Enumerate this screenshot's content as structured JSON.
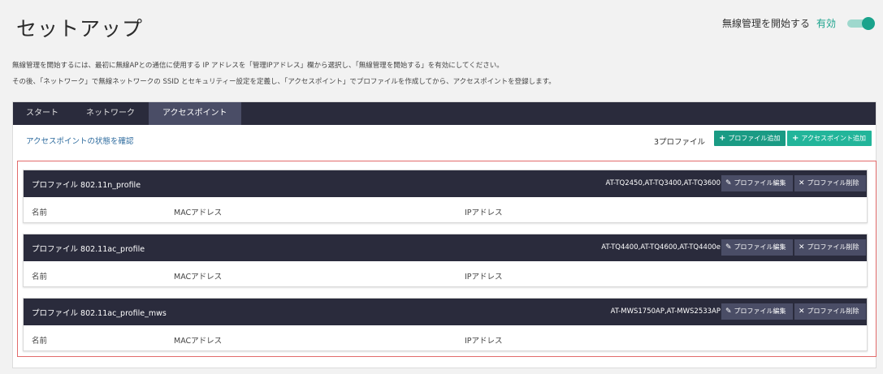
{
  "header": {
    "title": "セットアップ",
    "wireless_label": "無線管理を開始する",
    "wireless_status": "有効",
    "toggle_on": true
  },
  "instructions": {
    "line1": "無線管理を開始するには、最初に無線APとの通信に使用する IP アドレスを「管理IPアドレス」欄から選択し、「無線管理を開始する」を有効にしてください。",
    "line2": "その後、「ネットワーク」で無線ネットワークの SSID とセキュリティー設定を定義し、「アクセスポイント」でプロファイルを作成してから、アクセスポイントを登録します。"
  },
  "tabs": [
    {
      "label": "スタート",
      "active": false
    },
    {
      "label": "ネットワーク",
      "active": false
    },
    {
      "label": "アクセスポイント",
      "active": true
    }
  ],
  "toolbar": {
    "status_link": "アクセスポイントの状態を確認",
    "profile_count": "3プロファイル",
    "add_profile_label": "プロファイル追加",
    "add_ap_label": "アクセスポイント追加"
  },
  "columns": {
    "name": "名前",
    "mac": "MACアドレス",
    "ip": "IPアドレス"
  },
  "profiles": [
    {
      "name": "プロファイル 802.11n_profile",
      "models": "AT-TQ2450,AT-TQ3400,AT-TQ3600",
      "edit_label": "プロファイル編集",
      "delete_label": "プロファイル削除"
    },
    {
      "name": "プロファイル 802.11ac_profile",
      "models": "AT-TQ4400,AT-TQ4600,AT-TQ4400e",
      "edit_label": "プロファイル編集",
      "delete_label": "プロファイル削除"
    },
    {
      "name": "プロファイル 802.11ac_profile_mws",
      "models": "AT-MWS1750AP,AT-MWS2533AP",
      "edit_label": "プロファイル編集",
      "delete_label": "プロファイル削除"
    }
  ],
  "colors": {
    "accent": "#1a9b84",
    "navbar": "#2a2b3c",
    "highlight": "#e26b6b"
  }
}
